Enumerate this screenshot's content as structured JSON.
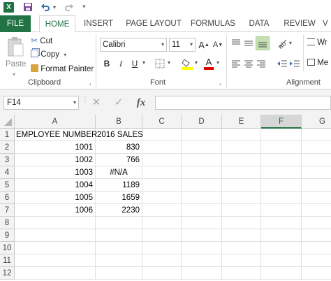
{
  "quick_access": {
    "logo": "X",
    "save_icon": "save-icon",
    "undo_icon": "undo-icon",
    "redo_icon": "redo-icon"
  },
  "tabs": [
    {
      "label": "FILE"
    },
    {
      "label": "HOME"
    },
    {
      "label": "INSERT"
    },
    {
      "label": "PAGE LAYOUT"
    },
    {
      "label": "FORMULAS"
    },
    {
      "label": "DATA"
    },
    {
      "label": "REVIEW"
    },
    {
      "label": "V"
    }
  ],
  "ribbon": {
    "clipboard": {
      "paste_label": "Paste",
      "cut_label": "Cut",
      "copy_label": "Copy",
      "format_painter_label": "Format Painter",
      "group_label": "Clipboard"
    },
    "font": {
      "font_name": "Calibri",
      "font_size": "11",
      "bold": "B",
      "italic": "I",
      "underline": "U",
      "grow": "A",
      "shrink": "A",
      "font_color_letter": "A",
      "group_label": "Font"
    },
    "alignment": {
      "wrap_label": "Wr",
      "merge_label": "Me",
      "group_label": "Alignment"
    }
  },
  "formula_bar": {
    "name_box": "F14",
    "fx_label": "fx",
    "cancel_label": "✕",
    "enter_label": "✓",
    "formula": ""
  },
  "colors": {
    "file_tab": "#217346",
    "accent": "#217346",
    "selected_header": "#d6d6d6"
  },
  "sheet": {
    "columns": [
      "A",
      "B",
      "C",
      "D",
      "E",
      "F",
      "G"
    ],
    "selected_column": "F",
    "rows": [
      {
        "n": "1",
        "A": "EMPLOYEE NUMBER",
        "B": "2016 SALES"
      },
      {
        "n": "2",
        "A": "1001",
        "B": "830"
      },
      {
        "n": "3",
        "A": "1002",
        "B": "766"
      },
      {
        "n": "4",
        "A": "1003",
        "B": "#N/A"
      },
      {
        "n": "5",
        "A": "1004",
        "B": "1189"
      },
      {
        "n": "6",
        "A": "1005",
        "B": "1659"
      },
      {
        "n": "7",
        "A": "1006",
        "B": "2230"
      },
      {
        "n": "8",
        "A": "",
        "B": ""
      },
      {
        "n": "9",
        "A": "",
        "B": ""
      },
      {
        "n": "10",
        "A": "",
        "B": ""
      },
      {
        "n": "11",
        "A": "",
        "B": ""
      },
      {
        "n": "12",
        "A": "",
        "B": ""
      }
    ]
  }
}
